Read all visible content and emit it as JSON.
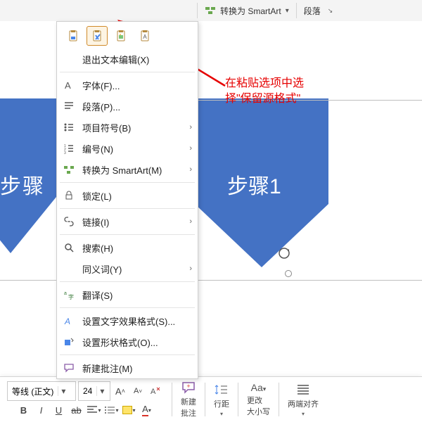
{
  "topbar": {
    "convert_smartart": "转换为 SmartArt",
    "paragraph": "段落"
  },
  "menu": {
    "exit_text_edit": "退出文本编辑(X)",
    "font": "字体(F)...",
    "paragraph": "段落(P)...",
    "bullets": "项目符号(B)",
    "numbering": "编号(N)",
    "convert_smartart": "转换为 SmartArt(M)",
    "lock": "锁定(L)",
    "link": "链接(I)",
    "search": "搜索(H)",
    "synonyms": "同义词(Y)",
    "translate": "翻译(S)",
    "text_effects": "设置文字效果格式(S)...",
    "shape_format": "设置形状格式(O)...",
    "new_comment": "新建批注(M)"
  },
  "annotation": {
    "line1": "在粘贴选项中选",
    "line2": "择\"保留源格式\""
  },
  "shapes": {
    "step1": "步骤1",
    "step_left": "步骤"
  },
  "format": {
    "font_name": "等线 (正文)",
    "font_size": "24",
    "new_comment": "新建\n批注",
    "line_spacing": "行距",
    "change_case": "更改\n大小写",
    "justify": "两端对齐"
  }
}
